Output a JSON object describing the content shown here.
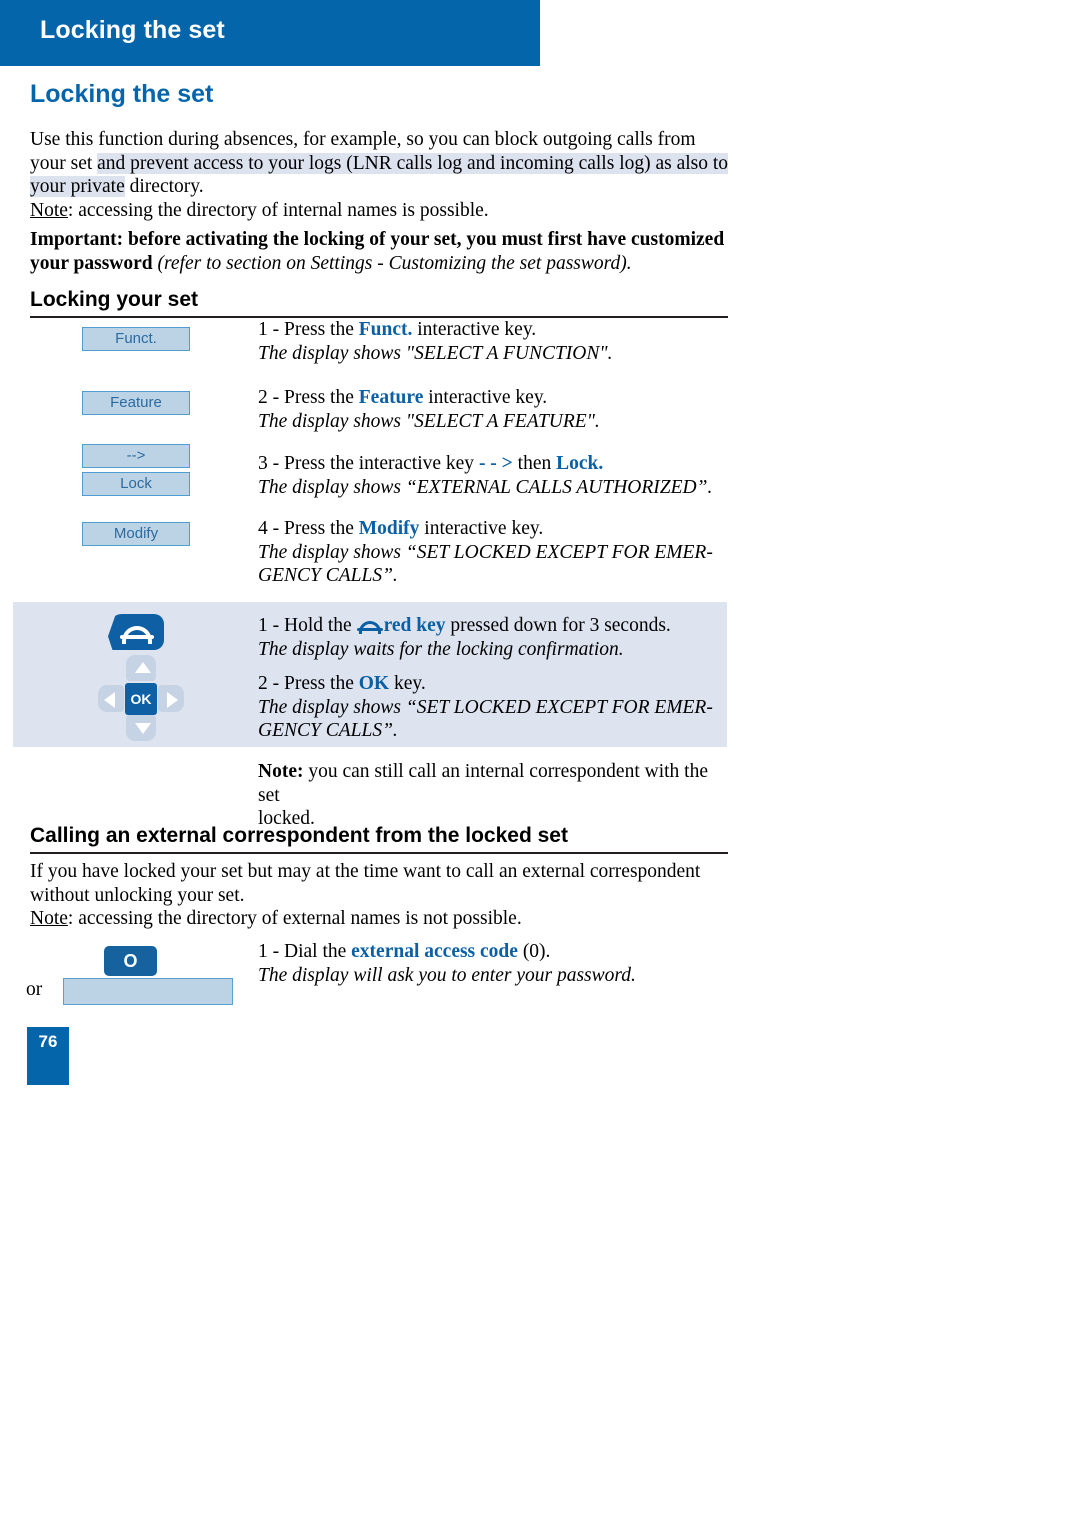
{
  "banner": {
    "running_head": "Locking the set"
  },
  "chapter": {
    "title": "Locking the set"
  },
  "intro": {
    "line1": "Use this function during absences, for example, so you can block outgoing calls from your set",
    "line2_highlighted": "and prevent access to your logs (LNR calls log and incoming calls log) as also to your private",
    "line3": "directory.",
    "note_label": "Note",
    "note_text": ": accessing the directory of internal names is possible."
  },
  "important": {
    "bold_part": "Important: before activating the locking of your set, you must first have customized your password",
    "italic_part": " (refer to section on Settings - Customizing the set password)."
  },
  "sections": {
    "locking_your_set": "Locking your set",
    "calling_external": "Calling an external correspondent from the locked set"
  },
  "keys": {
    "funct": "Funct.",
    "feature": "Feature",
    "arrow": "-->",
    "lock": "Lock",
    "modify": "Modify",
    "ok": "OK",
    "zero": "O"
  },
  "steps": [
    {
      "number": "1 - ",
      "pre": "Press the ",
      "key": "Funct.",
      "post": " interactive key.",
      "display": "The display shows \"SELECT A FUNCTION\"."
    },
    {
      "number": "2 - ",
      "pre": "Press the ",
      "key": "Feature",
      "post": " interactive key.",
      "display": "The display shows \"SELECT A FEATURE\"."
    },
    {
      "number": "3 - ",
      "pre": "Press the interactive key ",
      "key": "- - >",
      "mid": " then ",
      "key2": "Lock.",
      "post": "",
      "display": "The display shows “EXTERNAL CALLS AUTHORIZED”."
    },
    {
      "number": "4 - ",
      "pre": "Press the ",
      "key": "Modify",
      "post": " interactive key.",
      "display_line1": "The display shows “SET LOCKED EXCEPT FOR EMER-",
      "display_line2": "GENCY CALLS”."
    }
  ],
  "panel_steps": [
    {
      "number": "1 - ",
      "pre": "Hold the ",
      "key": "red key",
      "post": " pressed down for 3 seconds.",
      "display": "The display waits for the locking confirmation."
    },
    {
      "number": "2 - ",
      "pre": "Press the ",
      "key": "OK",
      "post": " key.",
      "display_line1": "The display shows “SET LOCKED EXCEPT FOR EMER-",
      "display_line2": "GENCY CALLS”."
    }
  ],
  "note_locked": {
    "label": "Note:",
    "line1": " you can still call an internal correspondent with the set",
    "line2": "locked."
  },
  "calling_body": {
    "line1": "If you have locked your set but may at the time want to call an external correspondent without",
    "line2": "unlocking your set.",
    "note_label": "Note",
    "note_text": ": accessing the directory of external names is not possible."
  },
  "dial_step": {
    "number": "1 - ",
    "pre": "Dial the ",
    "key": "external access code",
    "post": " (0).",
    "display": "The display will ask you to enter your password."
  },
  "or_label": "or",
  "page_number": "76",
  "colors": {
    "brand_blue": "#0565ab",
    "key_fill": "#bcd2e5",
    "key_border": "#4f9ed0",
    "panel_bg": "#dde3ef",
    "highlight": "#dde2ef",
    "dark_blue": "#0f5fa4"
  }
}
